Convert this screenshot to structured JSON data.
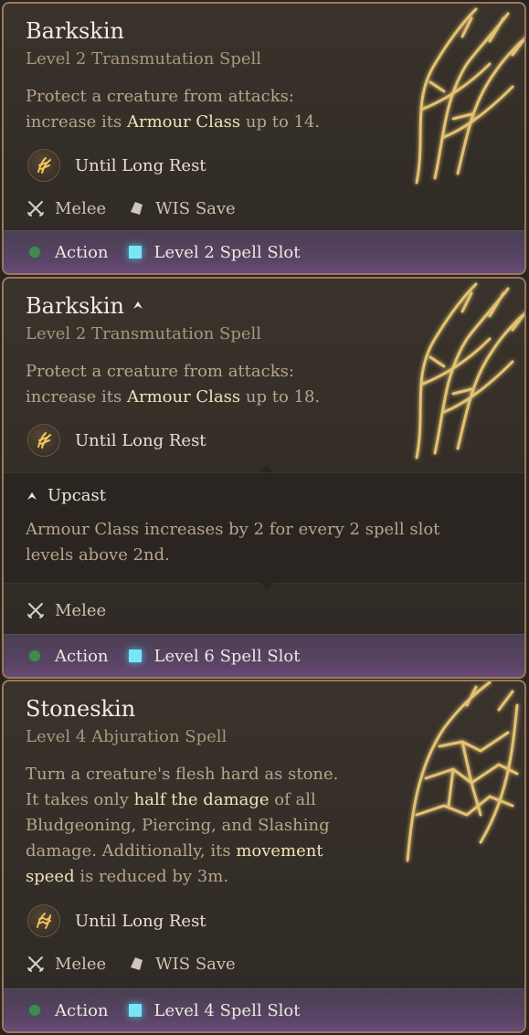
{
  "cards": [
    {
      "title": "Barkskin",
      "subtitle": "Level 2 Transmutation Spell",
      "desc_pre": "Protect a creature from attacks: increase its ",
      "desc_hl": "Armour Class",
      "desc_post": " up to 14.",
      "duration": "Until Long Rest",
      "range": "Melee",
      "save": "WIS Save",
      "action": "Action",
      "slot": "Level 2 Spell Slot",
      "icons": {
        "duration": "barkskin-icon",
        "range": "crossed-swords-icon",
        "save": "shield-icon"
      }
    },
    {
      "title": "Barkskin",
      "subtitle": "Level 2 Transmutation Spell",
      "desc_pre": "Protect a creature from attacks: increase its ",
      "desc_hl": "Armour Class",
      "desc_post": " up to 18.",
      "duration": "Until Long Rest",
      "upcast_label": "Upcast",
      "upcast_text": "Armour Class increases by 2 for every 2 spell slot levels above 2nd.",
      "range": "Melee",
      "action": "Action",
      "slot": "Level 6 Spell Slot",
      "icons": {
        "title": "upcast-icon",
        "duration": "barkskin-icon",
        "range": "crossed-swords-icon"
      }
    },
    {
      "title": "Stoneskin",
      "subtitle": "Level 4 Abjuration Spell",
      "desc_1": "Turn a creature's flesh hard as stone. It takes only ",
      "desc_hl1": "half the damage",
      "desc_2": " of all Bludgeoning, Piercing, and Slashing damage. Additionally, its ",
      "desc_hl2": "movement speed",
      "desc_3": " is reduced by 3m.",
      "duration": "Until Long Rest",
      "range": "Melee",
      "save": "WIS Save",
      "action": "Action",
      "slot": "Level 4 Spell Slot",
      "icons": {
        "duration": "stoneskin-icon",
        "range": "crossed-swords-icon",
        "save": "shield-icon"
      }
    }
  ],
  "colors": {
    "accent_gold": "#f5d06a",
    "action_green": "#3f8a52",
    "slot_cyan": "#79e6f5",
    "highlight": "#f0e3b8"
  }
}
